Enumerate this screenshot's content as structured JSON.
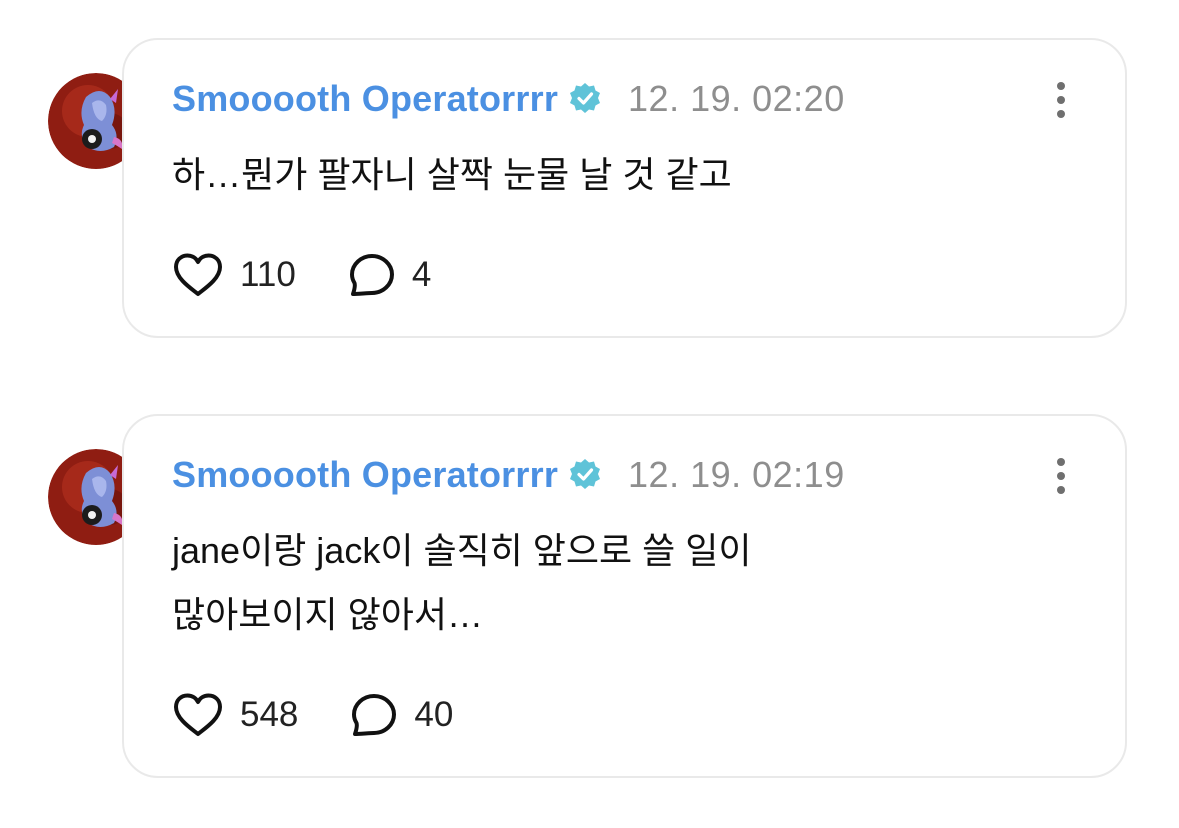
{
  "colors": {
    "username": "#4b90e2",
    "verified": "#5fc3d8",
    "timestamp": "#8e8e8e",
    "text": "#111111",
    "card_border": "#e9e9e9"
  },
  "icons": {
    "verified": "verified-badge-icon",
    "more": "more-vertical-icon",
    "like": "heart-icon",
    "reply": "speech-bubble-icon"
  },
  "comments": [
    {
      "username": "Smooooth Operatorrrr",
      "timestamp": "12. 19. 02:20",
      "text_lines": [
        "하…뭔가 팔자니 살짝 눈물 날 것 같고"
      ],
      "likes": "110",
      "replies": "4"
    },
    {
      "username": "Smooooth Operatorrrr",
      "timestamp": "12. 19. 02:19",
      "text_lines": [
        "jane이랑 jack이 솔직히 앞으로 쓸 일이",
        "많아보이지 않아서…"
      ],
      "likes": "548",
      "replies": "40"
    }
  ]
}
